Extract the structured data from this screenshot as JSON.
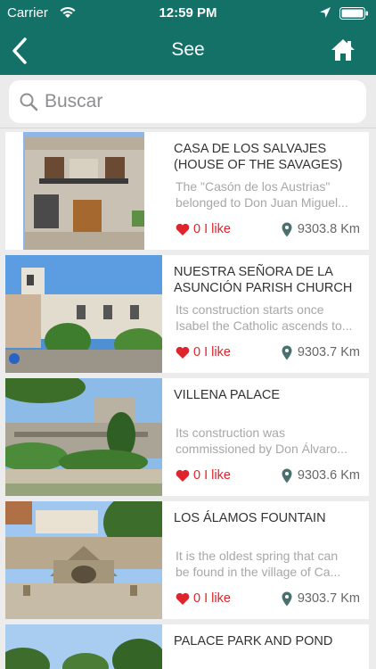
{
  "status_bar": {
    "carrier": "Carrier",
    "time": "12:59 PM"
  },
  "nav": {
    "title": "See",
    "back_icon": "chevron-left-icon",
    "home_icon": "home-icon"
  },
  "search": {
    "placeholder": "Buscar",
    "value": ""
  },
  "colors": {
    "primary": "#137168",
    "like": "#e0242b",
    "pin": "#4a7070"
  },
  "places": [
    {
      "title": "CASA DE LOS SALVAJES (HOUSE OF THE SAVAGES)",
      "desc1": "The \"Casón de los Austrias\"",
      "desc2": "belonged to Don Juan Miguel...",
      "likes": "0 I like",
      "distance": "9303.8 Km"
    },
    {
      "title": "NUESTRA SEÑORA DE LA ASUNCIÓN PARISH CHURCH",
      "desc1": "Its construction starts once",
      "desc2": "Isabel the Catholic ascends to...",
      "likes": "0 I like",
      "distance": "9303.7 Km"
    },
    {
      "title": "VILLENA PALACE",
      "desc1": "Its construction was",
      "desc2": "commissioned by Don Álvaro...",
      "likes": "0 I like",
      "distance": "9303.6 Km"
    },
    {
      "title": "LOS ÁLAMOS FOUNTAIN",
      "desc1": "It is the oldest spring that can",
      "desc2": "be found in the village of Ca...",
      "likes": "0 I like",
      "distance": "9303.7 Km"
    },
    {
      "title": "PALACE PARK AND POND",
      "desc1": "",
      "desc2": "",
      "likes": "",
      "distance": ""
    }
  ]
}
